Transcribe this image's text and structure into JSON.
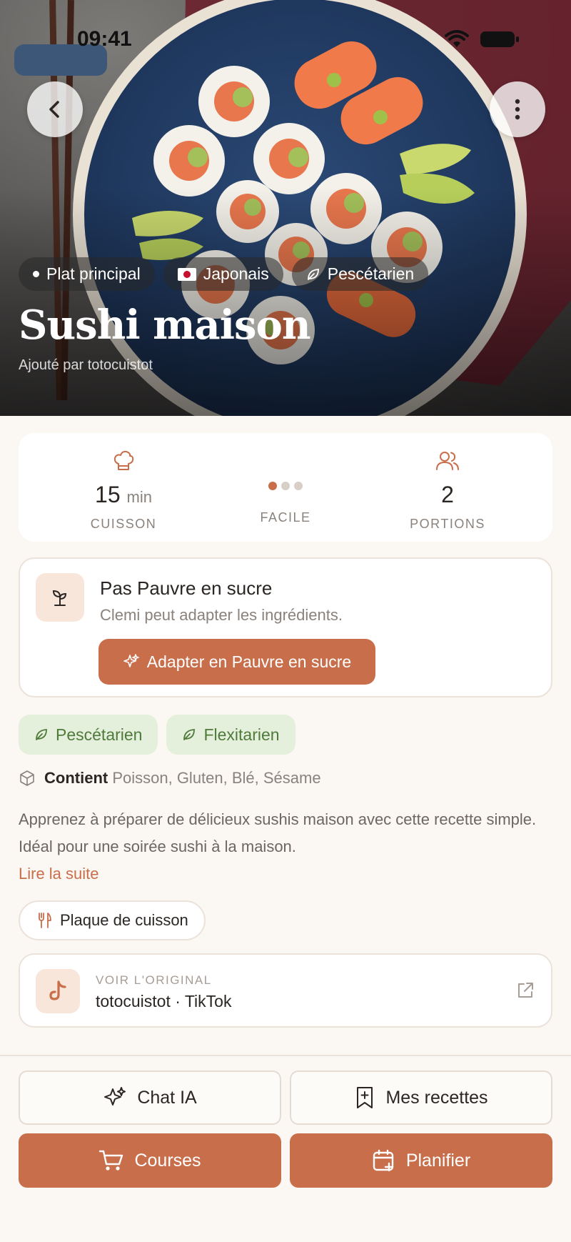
{
  "status": {
    "time": "09:41"
  },
  "hero": {
    "tags": [
      {
        "label": "Plat principal",
        "icon": "dot-icon"
      },
      {
        "label": "Japonais",
        "icon": "japan-flag-icon"
      },
      {
        "label": "Pescétarien",
        "icon": "leaf-icon"
      }
    ],
    "title": "Sushi maison",
    "subtitle": "Ajouté par totocuistot"
  },
  "stats": {
    "time": {
      "value": "15",
      "unit": "min",
      "label": "CUISSON"
    },
    "difficulty": {
      "label": "FACILE",
      "level": 1,
      "max": 3
    },
    "servings": {
      "value": "2",
      "label": "PORTIONS"
    }
  },
  "adapt": {
    "title": "Pas Pauvre en sucre",
    "subtitle": "Clemi peut adapter les ingrédients.",
    "button": "Adapter en Pauvre en sucre"
  },
  "diets": [
    "Pescétarien",
    "Flexitarien"
  ],
  "allergens": {
    "label": "Contient",
    "value": "Poisson, Gluten, Blé, Sésame"
  },
  "description": "Apprenez à préparer de délicieux sushis maison avec cette recette simple. Idéal pour une soirée sushi à la maison.",
  "read_more": "Lire la suite",
  "equipment": "Plaque de cuisson",
  "source": {
    "kicker": "VOIR L'ORIGINAL",
    "value": "totocuistot · TikTok"
  },
  "actions": {
    "chat": "Chat IA",
    "recipes": "Mes recettes",
    "groceries": "Courses",
    "plan": "Planifier"
  },
  "colors": {
    "accent": "#c96e4b",
    "diet_bg": "#e4f0dc",
    "diet_text": "#4f7a3a",
    "background": "#fbf7f2"
  }
}
